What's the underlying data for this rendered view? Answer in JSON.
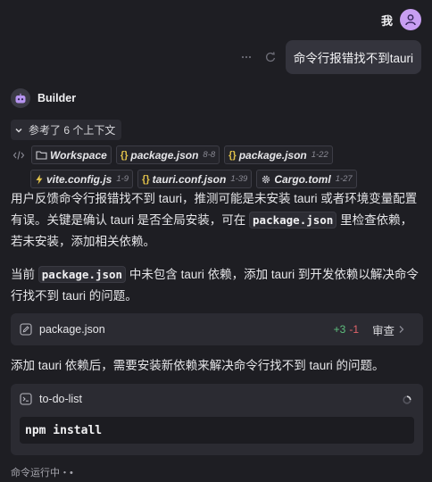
{
  "user": {
    "name": "我",
    "avatar_icon": "user-icon",
    "avatar_color": "#c89ef2"
  },
  "user_message": {
    "text": "命令行报错找不到tauri",
    "actions": [
      "more-icon",
      "retry-icon"
    ]
  },
  "assistant": {
    "name": "Builder",
    "avatar_icon": "robot-icon"
  },
  "context": {
    "toggle_label": "参考了 6 个上下文",
    "chips": [
      {
        "icon": "folder-icon",
        "label": "Workspace",
        "range": ""
      },
      {
        "icon": "braces-icon",
        "label": "package.json",
        "range": "8-8"
      },
      {
        "icon": "braces-icon",
        "label": "package.json",
        "range": "1-22"
      },
      {
        "icon": "bolt-icon",
        "label": "vite.config.js",
        "range": "1-9"
      },
      {
        "icon": "braces-icon",
        "label": "tauri.conf.json",
        "range": "1-39"
      },
      {
        "icon": "gear-icon",
        "label": "Cargo.toml",
        "range": "1-27"
      }
    ]
  },
  "para1": {
    "a": "用户反馈命令行报错找不到 tauri，推测可能是未安装 tauri 或者环境变量配置有误。关键是确认 tauri 是否全局安装，可在 ",
    "code": "package.json",
    "b": " 里检查依赖，若未安装，添加相关依赖。"
  },
  "para2": {
    "a": "当前 ",
    "code": "package.json",
    "b": " 中未包含 tauri 依赖，添加 tauri 到开发依赖以解决命令行找不到 tauri 的问题。"
  },
  "file_change": {
    "name": "package.json",
    "added": "+3",
    "removed": "-1",
    "review_label": "审查"
  },
  "para3": {
    "text": "添加 tauri 依赖后，需要安装新依赖来解决命令行找不到 tauri 的问题。"
  },
  "terminal": {
    "title": "to-do-list",
    "command": "npm install"
  },
  "status": {
    "text": "命令运行中・•"
  },
  "colors": {
    "background": "#1e1e23",
    "card": "#2b2b32",
    "added": "#5ec07e",
    "removed": "#e0646a",
    "bolt": "#e2c24a"
  }
}
